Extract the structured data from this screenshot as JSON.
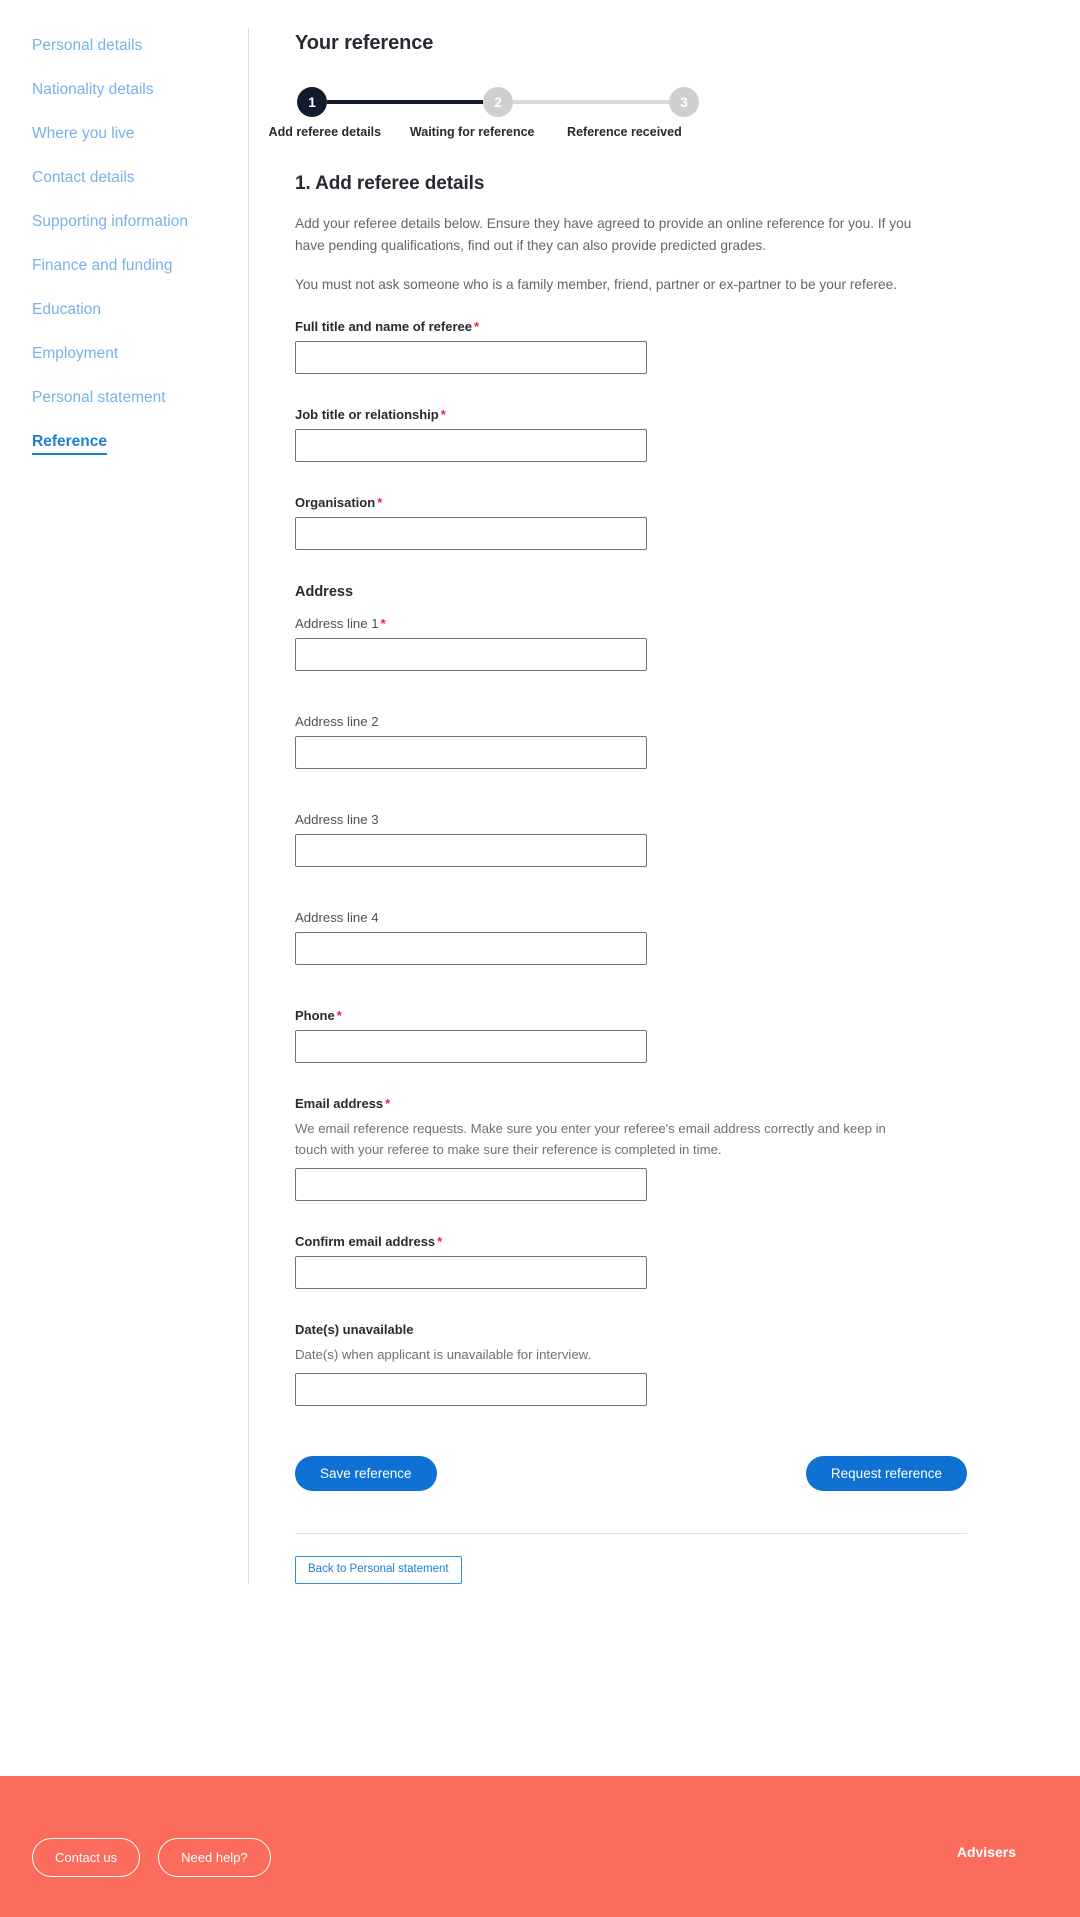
{
  "sidebar": {
    "items": [
      {
        "label": "Personal details",
        "active": false
      },
      {
        "label": "Nationality details",
        "active": false
      },
      {
        "label": "Where you live",
        "active": false
      },
      {
        "label": "Contact details",
        "active": false
      },
      {
        "label": "Supporting information",
        "active": false
      },
      {
        "label": "Finance and funding",
        "active": false
      },
      {
        "label": "Education",
        "active": false
      },
      {
        "label": "Employment",
        "active": false
      },
      {
        "label": "Personal statement",
        "active": false
      },
      {
        "label": "Reference",
        "active": true
      }
    ]
  },
  "main": {
    "page_title": "Your reference",
    "stepper": {
      "steps": [
        {
          "number": "1",
          "label": "Add referee details",
          "state": "active"
        },
        {
          "number": "2",
          "label": "Waiting for reference",
          "state": "todo"
        },
        {
          "number": "3",
          "label": "Reference received",
          "state": "todo"
        }
      ]
    },
    "section_title": "1. Add referee details",
    "intro_paragraph": "Add your referee details below. Ensure they have agreed to provide an online reference for you. If you have pending qualifications, find out if they can also provide predicted grades.",
    "warning_paragraph": "You must not ask someone who is a family member, friend, partner or ex-partner to be your referee.",
    "address_heading": "Address",
    "required_marker": "*",
    "fields": [
      {
        "name": "full-title-and-name-of-referee",
        "label": "Full title and name of referee",
        "required": true,
        "bold": true,
        "value": "",
        "placeholder": ""
      },
      {
        "name": "job-title-or-relationship",
        "label": "Job title or relationship",
        "required": true,
        "bold": true,
        "value": "",
        "placeholder": ""
      },
      {
        "name": "organisation",
        "label": "Organisation",
        "required": true,
        "bold": true,
        "value": "",
        "placeholder": ""
      },
      {
        "name": "address-line-1",
        "label": "Address line 1",
        "required": true,
        "bold": false,
        "value": "",
        "placeholder": ""
      },
      {
        "name": "address-line-2",
        "label": "Address line 2",
        "required": false,
        "bold": false,
        "value": "",
        "placeholder": ""
      },
      {
        "name": "address-line-3",
        "label": "Address line 3",
        "required": false,
        "bold": false,
        "value": "",
        "placeholder": ""
      },
      {
        "name": "address-line-4",
        "label": "Address line 4",
        "required": false,
        "bold": false,
        "value": "",
        "placeholder": ""
      },
      {
        "name": "phone",
        "label": "Phone",
        "required": true,
        "bold": true,
        "value": "",
        "placeholder": ""
      },
      {
        "name": "email-address",
        "label": "Email address",
        "required": true,
        "bold": true,
        "value": "",
        "placeholder": "",
        "hint": "We email reference requests. Make sure you enter your referee's email address correctly and keep in touch with your referee to make sure their reference is completed in time."
      },
      {
        "name": "confirm-email-address",
        "label": "Confirm email address",
        "required": true,
        "bold": true,
        "value": "",
        "placeholder": ""
      },
      {
        "name": "dates-unavailable",
        "label": "Date(s) unavailable",
        "required": false,
        "bold": true,
        "value": "",
        "placeholder": "",
        "hint": "Date(s) when applicant is unavailable for interview."
      }
    ],
    "buttons": {
      "save": "Save reference",
      "request": "Request reference",
      "back": "Back to Personal statement"
    }
  },
  "footer": {
    "buttons": [
      "Contact us",
      "Need help?"
    ],
    "heading": "Advisers"
  },
  "colors": {
    "accent_blue": "#0f71d3",
    "link_blue": "#7ab0ea",
    "active_blue": "#1d7fd4",
    "step_active": "#111d2c",
    "step_todo": "#cfcfcf",
    "required_red": "#e8243f",
    "footer_coral": "#fb6c5c"
  }
}
